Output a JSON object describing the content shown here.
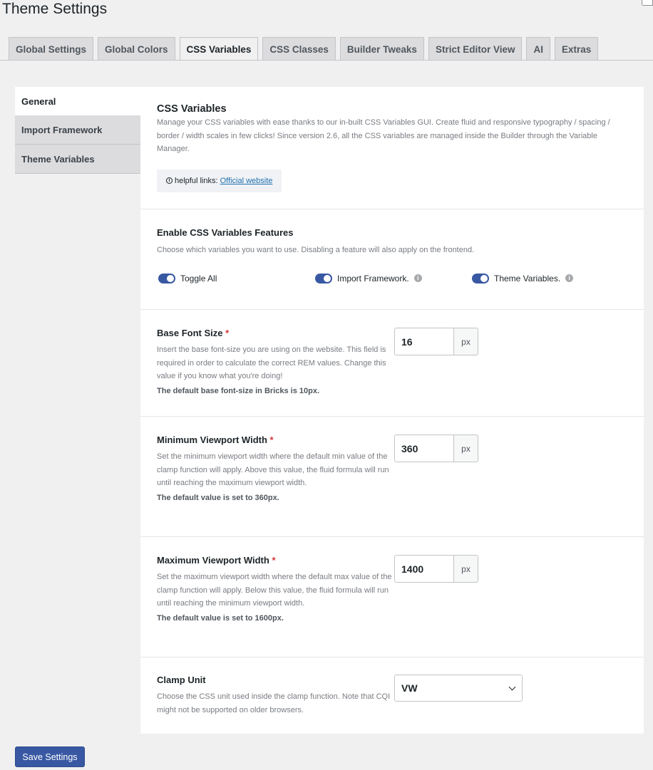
{
  "page": {
    "title": "Theme Settings"
  },
  "tabs": [
    {
      "label": "Global Settings",
      "active": false
    },
    {
      "label": "Global Colors",
      "active": false
    },
    {
      "label": "CSS Variables",
      "active": true
    },
    {
      "label": "CSS Classes",
      "active": false
    },
    {
      "label": "Builder Tweaks",
      "active": false
    },
    {
      "label": "Strict Editor View",
      "active": false
    },
    {
      "label": "AI",
      "active": false
    },
    {
      "label": "Extras",
      "active": false
    }
  ],
  "sidenav": [
    {
      "label": "General",
      "active": true
    },
    {
      "label": "Import Framework",
      "active": false
    },
    {
      "label": "Theme Variables",
      "active": false
    }
  ],
  "intro": {
    "title": "CSS Variables",
    "desc": "Manage your CSS variables with ease thanks to our in-built CSS Variables GUI. Create fluid and responsive typography / spacing / border / width scales in few clicks! Since version 2.6, all the CSS variables are managed inside the Builder through the Variable Manager.",
    "help_prefix": "helpful links:",
    "help_link": "Official website",
    "help_icon": "i"
  },
  "features": {
    "title": "Enable CSS Variables Features",
    "desc": "Choose which variables you want to use. Disabling a feature will also apply on the frontend.",
    "toggles": [
      {
        "label": "Toggle All",
        "on": true,
        "tip": ""
      },
      {
        "label": "Import Framework.",
        "on": true,
        "tip": "i"
      },
      {
        "label": "Theme Variables.",
        "on": true,
        "tip": "i"
      }
    ]
  },
  "base_font": {
    "label": "Base Font Size",
    "required": "*",
    "desc": "Insert the base font-size you are using on the website. This field is required in order to calculate the correct REM values. Change this value if you know what you're doing!",
    "note": "The default base font-size in Bricks is 10px.",
    "value": "16",
    "unit": "px"
  },
  "min_vw": {
    "label": "Minimum Viewport Width",
    "required": "*",
    "desc": "Set the minimum viewport width where the default min value of the clamp function will apply. Above this value, the fluid formula will run until reaching the maximum viewport width.",
    "note": "The default value is set to 360px.",
    "value": "360",
    "unit": "px"
  },
  "max_vw": {
    "label": "Maximum Viewport Width",
    "required": "*",
    "desc": "Set the maximum viewport width where the default max value of the clamp function will apply. Below this value, the fluid formula will run until reaching the minimum viewport width.",
    "note": "The default value is set to 1600px.",
    "value": "1400",
    "unit": "px"
  },
  "clamp_unit": {
    "label": "Clamp Unit",
    "desc": "Choose the CSS unit used inside the clamp function. Note that CQI might not be supported on older browsers.",
    "value": "VW"
  },
  "save": {
    "label": "Save Settings"
  },
  "colors": {
    "accent": "#3858a3",
    "required": "#d63638"
  }
}
